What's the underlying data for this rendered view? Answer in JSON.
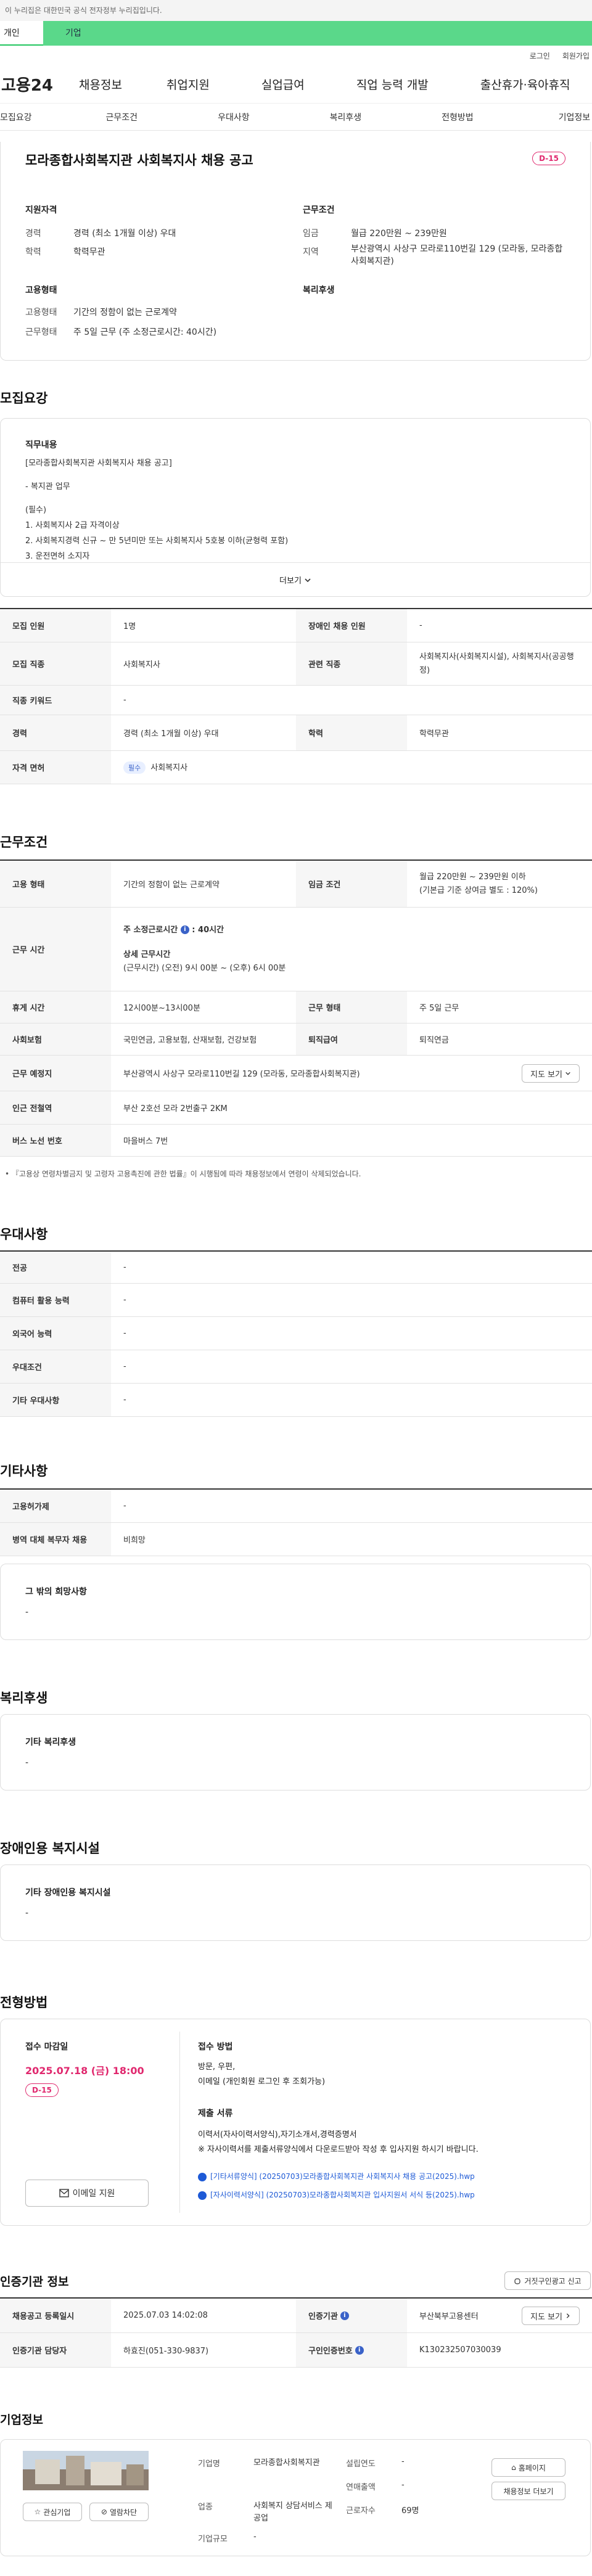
{
  "gov": {
    "notice": "이 누리집은 대한민국 공식 전자정부 누리집입니다."
  },
  "usertabs": [
    "개인",
    "기업"
  ],
  "util": [
    "로그인",
    "회원가입"
  ],
  "gnb": {
    "logo": "고용24",
    "menu": [
      "채용정보",
      "취업지원",
      "실업급여",
      "직업 능력 개발",
      "출산휴가·육아휴직"
    ]
  },
  "subnav": [
    "모집요강",
    "근무조건",
    "우대사항",
    "복리후생",
    "전형방법",
    "기업정보"
  ],
  "summary": {
    "title": "모라종합사회복지관 사회복지사 채용 공고",
    "dday": "D-15",
    "qual_title": "지원자격",
    "career_lbl": "경력",
    "career": "경력 (최소 1개월 이상) 우대",
    "edu_lbl": "학력",
    "edu": "학력무관",
    "cond_title": "근무조건",
    "wage_lbl": "임금",
    "wage": "월급 220만원 ~ 239만원",
    "region_lbl": "지역",
    "region": "부산광역시 사상구 모라로110번길 129 (모라동, 모라종합사회복지관)",
    "emp_title": "고용형태",
    "emptype_lbl": "고용형태",
    "emptype": "기간의 정함이 없는 근로계약",
    "worktype_lbl": "근무형태",
    "worktype": "주 5일 근무 (주 소정근로시간: 40시간)",
    "welfare_title": "복리후생"
  },
  "recruit": {
    "title": "모집요강",
    "duty_title": "직무내용",
    "lines": [
      "[모라종합사회복지관 사회복지사 채용 공고]",
      "- 복지관 업무",
      "(필수)",
      "1. 사회복지사 2급 자격이상",
      "2. 사회복지경력 신규 ~ 만 5년미만 또는 사회복지사 5호봉 이하(균형력 포함)",
      "3. 운전면허 소지자"
    ],
    "more": "더보기",
    "rows": [
      {
        "a": "모집 인원",
        "b": "1명",
        "c": "장애인 채용 인원",
        "d": "-"
      },
      {
        "a": "모집 직종",
        "b": "사회복지사",
        "c": "관련 직종",
        "d": "사회복지사(사회복지시설), 사회복지사(공공행정)"
      }
    ],
    "jobcode_lbl": "직종 키워드",
    "jobcode": "-",
    "career_lbl": "경력",
    "career": "경력 (최소 1개월 이상) 우대",
    "edu_lbl": "학력",
    "edu": "학력무관",
    "license_lbl": "자격 면허",
    "license_chip": "필수",
    "license": "사회복지사"
  },
  "work": {
    "title": "근무조건",
    "emp_lbl": "고용 형태",
    "emp": "기간의 정함이 없는 근로계약",
    "wage_lbl": "임금 조건",
    "wage1": "월급 220만원 ~ 239만원 이하",
    "wage2": "(기본급 기준 상여금 별도 : 120%)",
    "time_lbl": "근무 시간",
    "weekly": "주 소정근로시간",
    "weekly_val": "40시간",
    "detail_lbl": "상세 근무시간",
    "detail": "(근무시간) (오전) 9시 00분 ~ (오후) 6시 00분",
    "break_lbl": "휴게 시간",
    "break": "12시00분~13시00분",
    "form_lbl": "근무 형태",
    "form": "주 5일 근무",
    "ins_lbl": "사회보험",
    "ins": "국민연금, 고용보험, 산재보험, 건강보험",
    "retire_lbl": "퇴직급여",
    "retire": "퇴직연금",
    "place_lbl": "근무 예정지",
    "place": "부산광역시 사상구 모라로110번길 129 (모라동, 모라종합사회복지관)",
    "map": "지도 보기",
    "station_lbl": "인근 전철역",
    "station": "부산 2호선 모라 2번출구 2KM",
    "bus_lbl": "버스 노선 번호",
    "bus": "마을버스 7번",
    "note": "『고용상 연령차별금지 및 고령자 고용촉진에 관한 법률』이 시행됨에 따라 채용정보에서 연령이 삭제되었습니다."
  },
  "pref": {
    "title": "우대사항",
    "rows": [
      {
        "a": "전공",
        "b": "-"
      },
      {
        "a": "컴퓨터 활용 능력",
        "b": "-"
      },
      {
        "a": "외국어 능력",
        "b": "-"
      },
      {
        "a": "우대조건",
        "b": "-"
      },
      {
        "a": "기타 우대사항",
        "b": "-"
      }
    ]
  },
  "etc": {
    "title": "기타사항",
    "rows": [
      {
        "a": "고용허가제",
        "b": "-"
      },
      {
        "a": "병역 대체 복무자 채용",
        "b": "비희망"
      }
    ],
    "hope_title": "그 밖의 희망사항",
    "hope": "-"
  },
  "welfare": {
    "title": "복리후생",
    "sub": "기타 복리후생",
    "val": "-"
  },
  "disabled": {
    "title": "장애인용 복지시설",
    "sub": "기타 장애인용 복지시설",
    "val": "-"
  },
  "screen": {
    "title": "전형방법",
    "deadline_lbl": "접수 마감일",
    "deadline": "2025.07.18 (금) 18:00",
    "dday": "D-15",
    "apply": "이메일 지원",
    "method_lbl": "접수 방법",
    "method1": "방문, 우편,",
    "method2": "이메일 (개인회원 로그인 후 조회가능)",
    "docs_lbl": "제출 서류",
    "docs1": "이력서(자사이력서양식),자기소개서,경력증명서",
    "docs2": "※ 자사이력서를 제출서류양식에서 다운로드받아 작성 후 입사지원 하시기 바랍니다.",
    "file1": "[기타서류양식] (20250703)모라종합사회복지관 사회복지사 채용 공고(2025).hwp",
    "file2": "[자사이력서양식] (20250703)모라종합사회복지관 입사지원서 서식 등(2025).hwp"
  },
  "cert": {
    "title": "인증기관 정보",
    "report": "거짓구인광고 신고",
    "reg_lbl": "채용공고 등록일시",
    "reg": "2025.07.03 14:02:08",
    "org_lbl": "인증기관",
    "org": "부산북부고용센터",
    "map": "지도 보기",
    "mgr_lbl": "인증기관 담당자",
    "mgr": "하효진(051-330-9837)",
    "num_lbl": "구인인증번호",
    "num": "K130232507030039"
  },
  "company": {
    "title": "기업정보",
    "fav": "관심기업",
    "block": "열람차단",
    "name_lbl": "기업명",
    "name": "모라종합사회복지관",
    "found_lbl": "설립연도",
    "found": "-",
    "ind_lbl": "업종",
    "ind": "사회복지 상담서비스 제공업",
    "sales_lbl": "연매출액",
    "sales": "-",
    "emp_lbl": "근로자수",
    "emp": "69명",
    "size_lbl": "기업규모",
    "size": "-",
    "home": "홈페이지",
    "more": "채용정보 더보기"
  },
  "colors": {
    "green": "#5ad88a",
    "pink": "#e0286e",
    "blue": "#1e5ad6"
  }
}
